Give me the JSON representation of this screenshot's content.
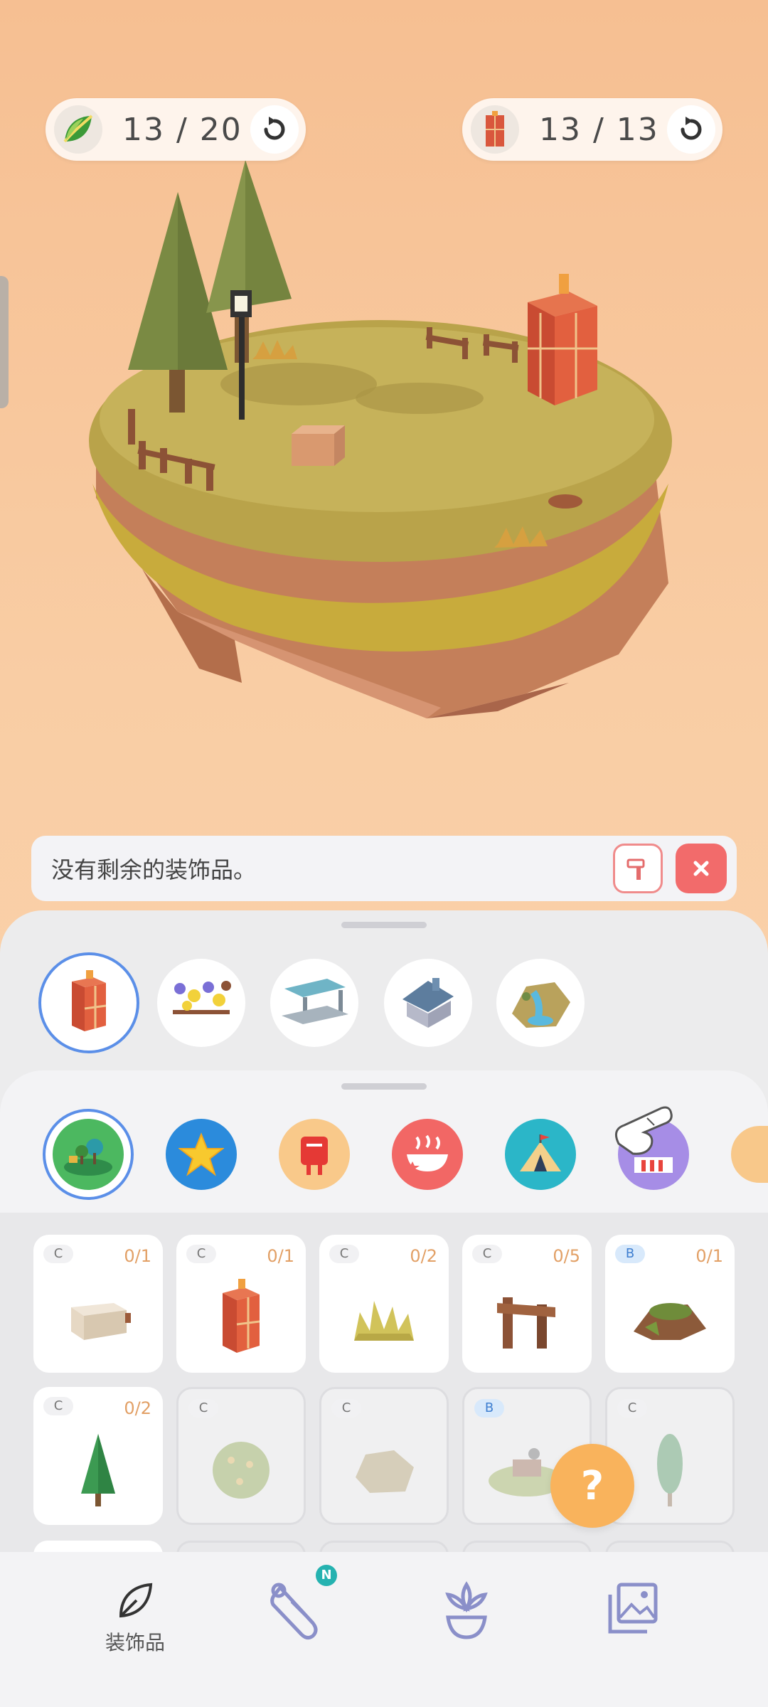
{
  "counters": {
    "leaf": {
      "icon": "leaf-icon",
      "text": "13 / 20"
    },
    "building": {
      "icon": "red-tower-icon",
      "text": "13 / 13"
    }
  },
  "message_bar": {
    "text": "没有剩余的装饰品。"
  },
  "categories": [
    {
      "icon": "red-tower-icon",
      "selected": true
    },
    {
      "icon": "flower-garden-icon",
      "selected": false
    },
    {
      "icon": "bus-stop-icon",
      "selected": false
    },
    {
      "icon": "house-icon",
      "selected": false
    },
    {
      "icon": "waterfall-icon",
      "selected": false
    }
  ],
  "filters": [
    {
      "icon": "nature-icon",
      "selected": true
    },
    {
      "icon": "star-icon",
      "selected": false
    },
    {
      "icon": "mailbox-icon",
      "selected": false
    },
    {
      "icon": "hot-food-icon",
      "selected": false
    },
    {
      "icon": "tent-icon",
      "selected": false
    },
    {
      "icon": "snow-house-icon",
      "selected": false
    }
  ],
  "items": [
    {
      "grade": "C",
      "count": "0/1",
      "icon": "planter-box-icon",
      "available": true
    },
    {
      "grade": "C",
      "count": "0/1",
      "icon": "red-tower-icon",
      "available": true
    },
    {
      "grade": "C",
      "count": "0/2",
      "icon": "grass-tuft-icon",
      "available": true
    },
    {
      "grade": "C",
      "count": "0/5",
      "icon": "wooden-fence-icon",
      "available": true
    },
    {
      "grade": "B",
      "count": "0/1",
      "icon": "tree-stump-icon",
      "available": true
    },
    {
      "grade": "C",
      "count": "0/2",
      "icon": "pine-tree-icon",
      "available": true
    },
    {
      "grade": "C",
      "count": "",
      "icon": "round-bush-icon",
      "available": false
    },
    {
      "grade": "C",
      "count": "",
      "icon": "rock-icon",
      "available": false
    },
    {
      "grade": "B",
      "count": "",
      "icon": "campsite-icon",
      "available": false
    },
    {
      "grade": "C",
      "count": "",
      "icon": "cypress-tree-icon",
      "available": false
    }
  ],
  "help_button": {
    "label": "?"
  },
  "bottom_nav": [
    {
      "icon": "leaf-outline-icon",
      "label": "装饰品"
    },
    {
      "icon": "scroll-icon",
      "label": "",
      "badge": "N"
    },
    {
      "icon": "plant-pot-icon",
      "label": ""
    },
    {
      "icon": "gallery-icon",
      "label": ""
    }
  ],
  "colors": {
    "accent_blue": "#5b8fe8",
    "close_red": "#f26b6b",
    "help_orange": "#f9b35c",
    "count_orange": "#e2a066",
    "badge_teal": "#25b2b0"
  }
}
